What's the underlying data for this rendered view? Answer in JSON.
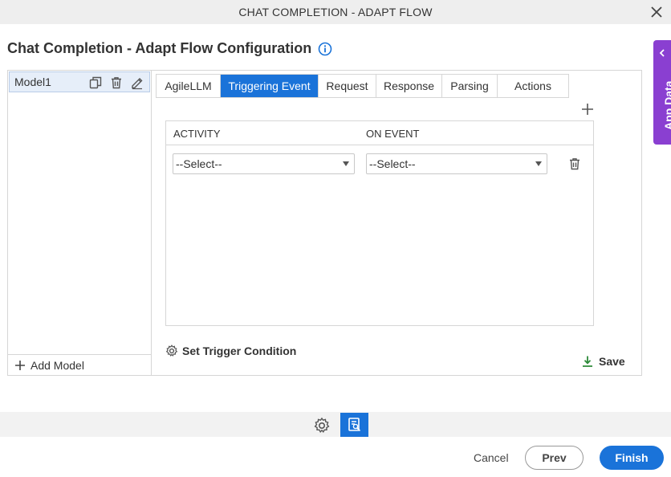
{
  "window": {
    "title": "CHAT COMPLETION - ADAPT FLOW",
    "close_icon": "close-icon"
  },
  "header": {
    "title": "Chat Completion - Adapt Flow Configuration",
    "info_icon": "info-icon"
  },
  "models": {
    "items": [
      {
        "label": "Model1",
        "selected": true
      }
    ],
    "add_label": "Add Model"
  },
  "tabs": [
    {
      "label": "AgileLLM",
      "active": false
    },
    {
      "label": "Triggering Event",
      "active": true
    },
    {
      "label": "Request",
      "active": false
    },
    {
      "label": "Response",
      "active": false
    },
    {
      "label": "Parsing",
      "active": false
    },
    {
      "label": "Actions",
      "active": false
    }
  ],
  "events_table": {
    "columns": [
      "ACTIVITY",
      "ON EVENT"
    ],
    "rows": [
      {
        "activity": "--Select--",
        "on_event": "--Select--"
      }
    ]
  },
  "trigger_condition_label": "Set Trigger Condition",
  "save_label": "Save",
  "side_panel": {
    "label": "App Data"
  },
  "footer": {
    "cancel_label": "Cancel",
    "prev_label": "Prev",
    "finish_label": "Finish"
  },
  "colors": {
    "accent": "#1a73d9",
    "side_panel": "#8a3fd1",
    "save_icon": "#2e8b3a"
  }
}
